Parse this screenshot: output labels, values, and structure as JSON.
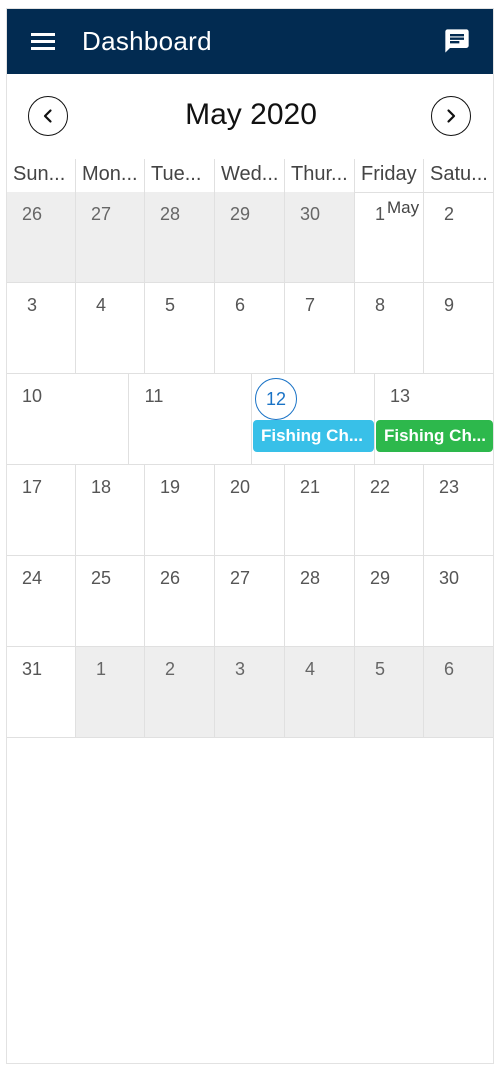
{
  "header": {
    "title": "Dashboard",
    "menu_icon": "hamburger-menu-icon",
    "chat_icon": "chat-icon"
  },
  "colors": {
    "appbar": "#022b51",
    "today": "#1a73c6",
    "event_blue": "#38c0e8",
    "event_green": "#2db84c",
    "other_month_bg": "#eeeeee"
  },
  "calendar": {
    "month_title": "May 2020",
    "prev_icon": "chevron-left-icon",
    "next_icon": "chevron-right-icon",
    "weekdays": [
      "Sun...",
      "Mon...",
      "Tue...",
      "Wed...",
      "Thur...",
      "Friday",
      "Satu..."
    ],
    "weeks": [
      {
        "days": [
          {
            "num": "26",
            "other": true
          },
          {
            "num": "27",
            "other": true
          },
          {
            "num": "28",
            "other": true
          },
          {
            "num": "29",
            "other": true
          },
          {
            "num": "30",
            "other": true
          },
          {
            "num": "1",
            "month_label": "May"
          },
          {
            "num": "2"
          }
        ]
      },
      {
        "days": [
          {
            "num": "3"
          },
          {
            "num": "4"
          },
          {
            "num": "5"
          },
          {
            "num": "6"
          },
          {
            "num": "7"
          },
          {
            "num": "8"
          },
          {
            "num": "9"
          }
        ]
      },
      {
        "days": [
          {
            "num": "10"
          },
          {
            "num": "11"
          },
          {
            "num": "12",
            "today": true
          },
          {
            "num": "13"
          }
        ],
        "events": [
          {
            "title": "Fishing Ch...",
            "color": "#38c0e8"
          },
          {
            "title": "Fishing Ch...",
            "color": "#2db84c"
          }
        ]
      },
      {
        "days": [
          {
            "num": "17"
          },
          {
            "num": "18"
          },
          {
            "num": "19"
          },
          {
            "num": "20"
          },
          {
            "num": "21"
          },
          {
            "num": "22"
          },
          {
            "num": "23"
          }
        ]
      },
      {
        "days": [
          {
            "num": "24"
          },
          {
            "num": "25"
          },
          {
            "num": "26"
          },
          {
            "num": "27"
          },
          {
            "num": "28"
          },
          {
            "num": "29"
          },
          {
            "num": "30"
          }
        ]
      },
      {
        "days": [
          {
            "num": "31"
          },
          {
            "num": "1",
            "other": true
          },
          {
            "num": "2",
            "other": true
          },
          {
            "num": "3",
            "other": true
          },
          {
            "num": "4",
            "other": true
          },
          {
            "num": "5",
            "other": true
          },
          {
            "num": "6",
            "other": true
          }
        ]
      }
    ]
  }
}
